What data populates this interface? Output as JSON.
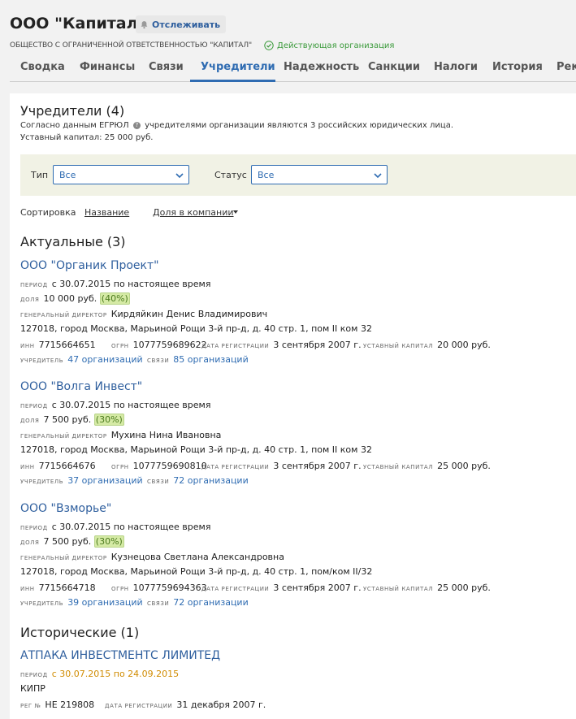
{
  "header": {
    "title": "ООО \"Капитал\"",
    "follow_label": "Отслеживать",
    "legal_name": "ОБЩЕСТВО С ОГРАНИЧЕННОЙ ОТВЕТСТВЕННОСТЬЮ \"КАПИТАЛ\"",
    "status": "Действующая организация",
    "status_color": "#3a9a3a"
  },
  "tabs": [
    {
      "label": "Сводка"
    },
    {
      "label": "Финансы"
    },
    {
      "label": "Связи"
    },
    {
      "label": "Учредители",
      "active": true
    },
    {
      "label": "Надежность"
    },
    {
      "label": "Санкции"
    },
    {
      "label": "Налоги"
    },
    {
      "label": "История"
    },
    {
      "label": "Рек"
    }
  ],
  "section": {
    "title": "Учредители (4)",
    "desc_before": "Согласно данным ЕГРЮЛ",
    "desc_after": "учредителями организации являются 3 российских юридических лица.",
    "capital": "Уставный капитал: 25 000 руб."
  },
  "filters": {
    "type_label": "Тип",
    "type_value": "Все",
    "status_label": "Статус",
    "status_value": "Все"
  },
  "sort": {
    "label": "Сортировка",
    "options": [
      "Название",
      "Доля в компании"
    ]
  },
  "labels": {
    "period": "период",
    "share": "доля",
    "director": "генеральный директор",
    "inn": "инн",
    "ogrn": "огрн",
    "reg_date": "дата регистрации",
    "capital": "уставный капитал",
    "founder": "учредитель",
    "links": "связи",
    "reg_no": "рег №"
  },
  "current": {
    "title": "Актуальные (3)",
    "items": [
      {
        "name": "ООО \"Органик Проект\"",
        "period": "с 30.07.2015 по настоящее время",
        "share_amount": "10 000 руб.",
        "share_percent": "(40%)",
        "director": "Кирдяйкин Денис Владимирович",
        "address": "127018, город Москва, Марьиной Рощи 3-й пр-д, д. 40 стр. 1, пом II ком 32",
        "inn": "7715664651",
        "ogrn": "1077759689622",
        "reg_date": "3 сентября 2007 г.",
        "capital": "20 000 руб.",
        "founder_of": "47 организаций",
        "links": "85 организаций"
      },
      {
        "name": "ООО \"Волга Инвест\"",
        "period": "с 30.07.2015 по настоящее время",
        "share_amount": "7 500 руб.",
        "share_percent": "(30%)",
        "director": "Мухина Нина Ивановна",
        "address": "127018, город Москва, Марьиной Рощи 3-й пр-д, д. 40 стр. 1, пом II ком 32",
        "inn": "7715664676",
        "ogrn": "1077759690810",
        "reg_date": "3 сентября 2007 г.",
        "capital": "25 000 руб.",
        "founder_of": "37 организаций",
        "links": "72 организации"
      },
      {
        "name": "ООО \"Взморье\"",
        "period": "с 30.07.2015 по настоящее время",
        "share_amount": "7 500 руб.",
        "share_percent": "(30%)",
        "director": "Кузнецова Светлана Александровна",
        "address": "127018, город Москва, Марьиной Рощи 3-й пр-д, д. 40 стр. 1, пом/ком II/32",
        "inn": "7715664718",
        "ogrn": "1077759694363",
        "reg_date": "3 сентября 2007 г.",
        "capital": "25 000 руб.",
        "founder_of": "39 организаций",
        "links": "72 организации"
      }
    ]
  },
  "historical": {
    "title": "Исторические (1)",
    "items": [
      {
        "name": "АТПАКА ИНВЕСТМЕНТС ЛИМИТЕД",
        "period": "с 30.07.2015 по 24.09.2015",
        "country": "КИПР",
        "reg_no": "НЕ 219808",
        "reg_date": "31 декабря 2007 г."
      }
    ]
  },
  "colors": {
    "accent": "#2f6cb2",
    "link": "#2f5f9e",
    "share_badge_bg": "#d5eaa5",
    "historical_period": "#d08b00",
    "filter_bg": "#f1f2e5"
  }
}
